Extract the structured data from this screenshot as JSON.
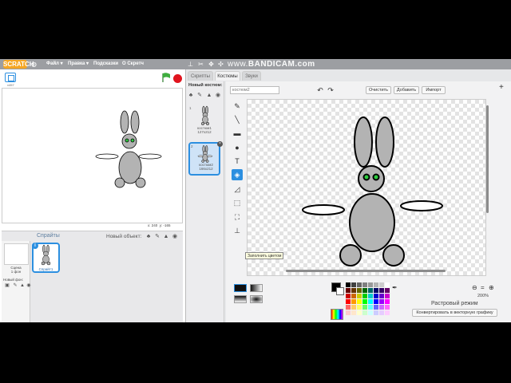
{
  "menubar": {
    "logo": "SCRATCH",
    "items": [
      "Файл ▾",
      "Правка ▾",
      "Подсказки",
      "О Скретч"
    ],
    "watermark_prefix": "www.",
    "watermark": "BANDICAM.com"
  },
  "stage": {
    "version": "v457",
    "coords": {
      "x_label": "x: 240",
      "y_label": "y: -165"
    }
  },
  "sprites_panel": {
    "title": "Спрайты",
    "new_object_label": "Новый объект:",
    "stage_name": "Сцена",
    "stage_bg_count": "1 фон",
    "new_background_label": "Новый фон:",
    "sprite1_name": "Спрайт1",
    "sprite1_info": "i"
  },
  "editor_tabs": [
    "Скрипты",
    "Костюмы",
    "Звуки"
  ],
  "costume_list": {
    "new_costume_label": "Новый костюм:",
    "costumes": [
      {
        "num": "1",
        "name": "костюм1",
        "size": "127x212"
      },
      {
        "num": "2",
        "name": "костюм2",
        "size": "166x212"
      }
    ]
  },
  "paint_editor": {
    "costume_name_placeholder": "костюм2",
    "clear_label": "Очистить",
    "add_label": "Добавить",
    "import_label": "Импорт",
    "tooltip": "Заполнить цветом",
    "zoom_level": "200%",
    "mode_label": "Растровый режим",
    "convert_label": "Конвертировать в векторную графику"
  },
  "palette_colors": [
    "#000000",
    "#404040",
    "#666666",
    "#808080",
    "#999999",
    "#b3b3b3",
    "#cccccc",
    "#ffffff",
    "#660000",
    "#663300",
    "#666600",
    "#006600",
    "#006666",
    "#000066",
    "#330066",
    "#660066",
    "#cc0000",
    "#cc6600",
    "#cccc00",
    "#00cc00",
    "#00cccc",
    "#0000cc",
    "#6600cc",
    "#cc00cc",
    "#ff0000",
    "#ff9900",
    "#ffff00",
    "#00ff00",
    "#00ffff",
    "#0000ff",
    "#9900ff",
    "#ff00ff",
    "#ff6666",
    "#ffcc66",
    "#ffff66",
    "#66ff66",
    "#66ffff",
    "#6666ff",
    "#cc66ff",
    "#ff66ff",
    "#ffcccc",
    "#ffe6cc",
    "#ffffcc",
    "#ccffcc",
    "#ccffff",
    "#ccccff",
    "#e6ccff",
    "#ffccff"
  ],
  "colors": {
    "accent": "#2c8fe0",
    "rabbit_fill": "#b3b3b3",
    "rabbit_eye": "#2ecc40",
    "menubar": "#9c9ea2"
  }
}
